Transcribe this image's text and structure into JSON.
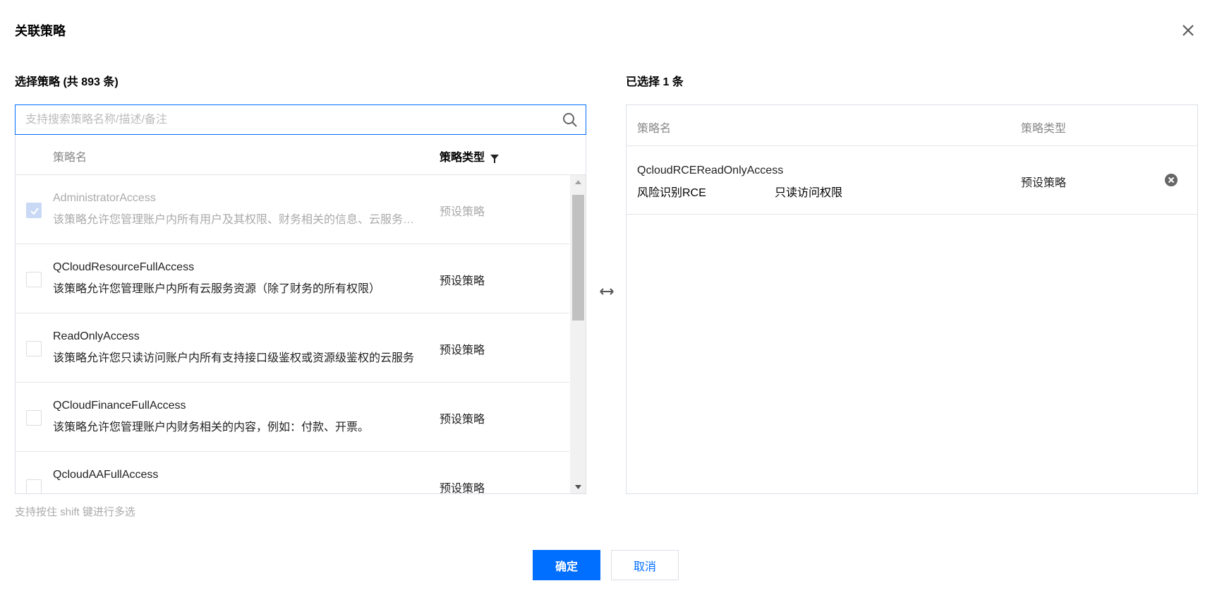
{
  "dialog": {
    "title": "关联策略",
    "close_icon": "close-icon"
  },
  "left": {
    "title": "选择策略  (共 893 条)",
    "search_placeholder": "支持搜索策略名称/描述/备注",
    "search_icon": "search-icon",
    "columns": {
      "name": "策略名",
      "type": "策略类型",
      "filter_icon": "filter-icon"
    },
    "rows": [
      {
        "name": "AdministratorAccess",
        "desc": "该策略允许您管理账户内所有用户及其权限、财务相关的信息、云服务资产。",
        "type": "预设策略",
        "checked": true,
        "disabled": true
      },
      {
        "name": "QCloudResourceFullAccess",
        "desc": "该策略允许您管理账户内所有云服务资源（除了财务的所有权限）",
        "type": "预设策略",
        "checked": false,
        "disabled": false
      },
      {
        "name": "ReadOnlyAccess",
        "desc": "该策略允许您只读访问账户内所有支持接口级鉴权或资源级鉴权的云服务",
        "type": "预设策略",
        "checked": false,
        "disabled": false
      },
      {
        "name": "QCloudFinanceFullAccess",
        "desc": "该策略允许您管理账户内财务相关的内容，例如：付款、开票。",
        "type": "预设策略",
        "checked": false,
        "disabled": false
      },
      {
        "name": "QcloudAAFullAccess",
        "desc": "",
        "type": "预设策略",
        "checked": false,
        "disabled": false
      }
    ],
    "hint": "支持按住 shift 键进行多选"
  },
  "right": {
    "title": "已选择 1 条",
    "columns": {
      "name": "策略名",
      "type": "策略类型"
    },
    "rows": [
      {
        "name": "QcloudRCEReadOnlyAccess",
        "service": "风险识别RCE",
        "scope": "只读访问权限",
        "type": "预设策略"
      }
    ]
  },
  "footer": {
    "ok_label": "确定",
    "cancel_label": "取消"
  },
  "colors": {
    "accent": "#006eff",
    "border": "#dcdfe6"
  }
}
